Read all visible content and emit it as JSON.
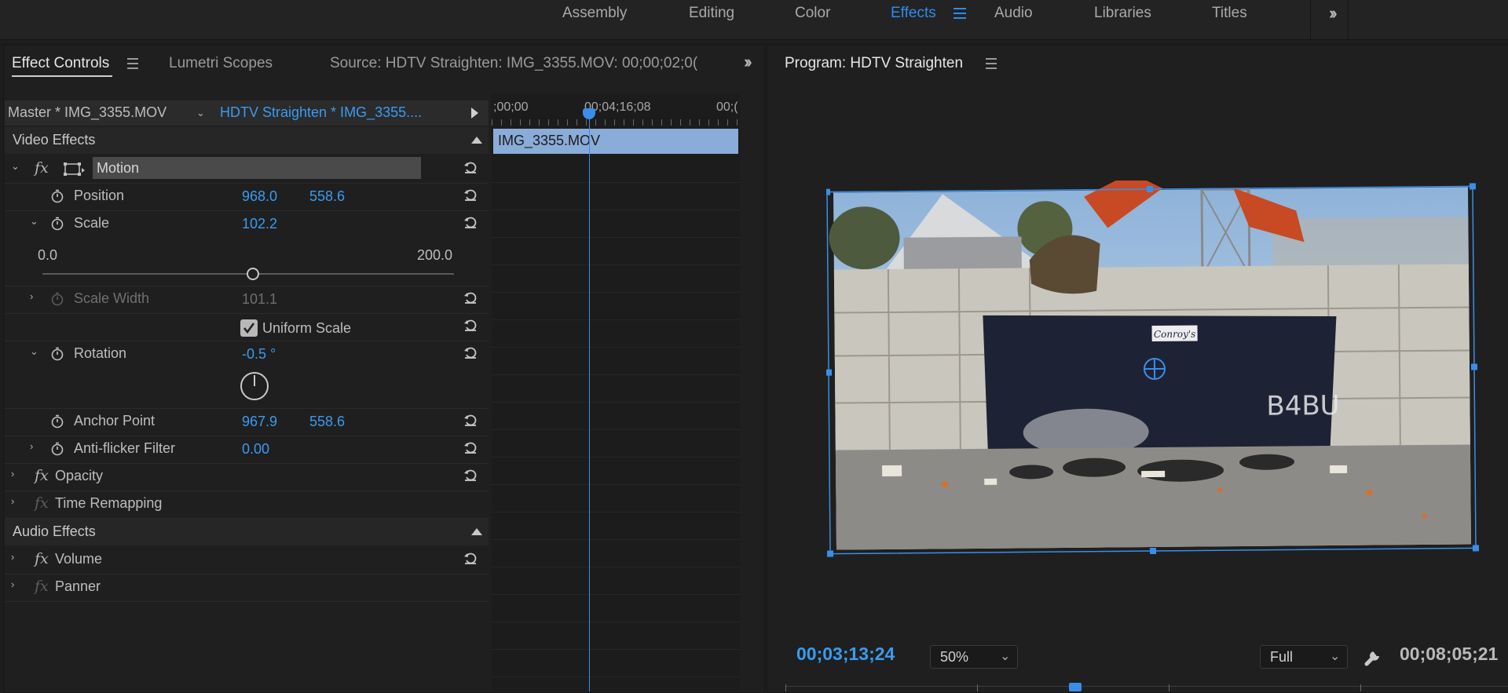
{
  "workspaces": [
    {
      "label": "Assembly",
      "active": false
    },
    {
      "label": "Editing",
      "active": false
    },
    {
      "label": "Color",
      "active": false
    },
    {
      "label": "Effects",
      "active": true
    },
    {
      "label": "Audio",
      "active": false
    },
    {
      "label": "Libraries",
      "active": false
    },
    {
      "label": "Titles",
      "active": false
    }
  ],
  "left_tabs": {
    "effect_controls": "Effect Controls",
    "lumetri_scopes": "Lumetri Scopes",
    "source": "Source: HDTV Straighten: IMG_3355.MOV: 00;00;02;0("
  },
  "clip_header": {
    "master": "Master * IMG_3355.MOV",
    "sequence": "HDTV Straighten * IMG_3355...."
  },
  "mini_timeline": {
    "time_start": ";00;00",
    "time_mid": "00;04;16;08",
    "time_end": "00;(",
    "clip_name": "IMG_3355.MOV"
  },
  "sections": {
    "video_effects": "Video Effects",
    "audio_effects": "Audio Effects"
  },
  "motion": {
    "label": "Motion",
    "position_label": "Position",
    "position_x": "968.0",
    "position_y": "558.6",
    "scale_label": "Scale",
    "scale_value": "102.2",
    "scale_min": "0.0",
    "scale_max": "200.0",
    "scale_fraction": 0.511,
    "scale_width_label": "Scale Width",
    "scale_width_value": "101.1",
    "uniform_scale_label": "Uniform Scale",
    "uniform_scale_checked": true,
    "rotation_label": "Rotation",
    "rotation_value": "-0.5 °",
    "anchor_label": "Anchor Point",
    "anchor_x": "967.9",
    "anchor_y": "558.6",
    "antiflicker_label": "Anti-flicker Filter",
    "antiflicker_value": "0.00"
  },
  "opacity_label": "Opacity",
  "time_remap_label": "Time Remapping",
  "volume_label": "Volume",
  "panner_label": "Panner",
  "program": {
    "title": "Program: HDTV Straighten",
    "current_time": "00;03;13;24",
    "zoom": "50%",
    "quality": "Full",
    "duration": "00;08;05;21",
    "dumpster_sign": "Conroy's"
  },
  "colors": {
    "accent": "#2d8ceb",
    "value_blue": "#3a9bf0",
    "clip_bar": "#8aacd8"
  }
}
